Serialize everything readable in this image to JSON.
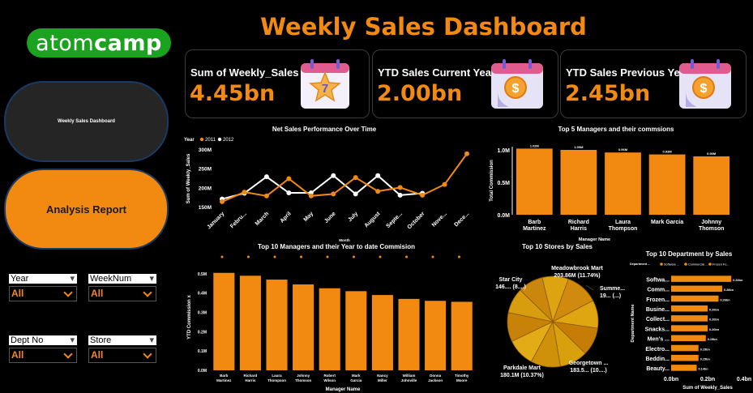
{
  "logo": {
    "light": "atom",
    "bold": "camp"
  },
  "title": "Weekly Sales Dashboard",
  "nav": {
    "dashboard_label": "Weekly Sales Dashboard",
    "report_label": "Analysis Report"
  },
  "kpis": [
    {
      "label": "Sum of Weekly_Sales",
      "value": "4.45bn",
      "icon": "star-calendar-icon"
    },
    {
      "label": "YTD Sales Current Year",
      "value": "2.00bn",
      "icon": "dollar-calendar-icon"
    },
    {
      "label": "YTD Sales Previous Year",
      "value": "2.45bn",
      "icon": "dollar-calendar-icon"
    }
  ],
  "calendar_badge": "7",
  "slicers": [
    {
      "label": "Year",
      "value": "All"
    },
    {
      "label": "WeekNum",
      "value": "All"
    },
    {
      "label": "Dept No",
      "value": "All"
    },
    {
      "label": "Store",
      "value": "All"
    }
  ],
  "colors": {
    "accent": "#f28a12",
    "white": "#ffffff",
    "background": "#000000"
  },
  "chart_data": [
    {
      "type": "line",
      "title": "Net Sales Performance Over Time",
      "xlabel": "Month",
      "ylabel": "Sum of Weekly_Sales",
      "legend_title": "Year",
      "categories": [
        "January",
        "Febru...",
        "March",
        "April",
        "May",
        "June",
        "July",
        "August",
        "Septe...",
        "October",
        "Nove...",
        "Dece..."
      ],
      "y_ticks": [
        "150M",
        "200M",
        "250M",
        "300M"
      ],
      "ylim": [
        150,
        300
      ],
      "series": [
        {
          "name": "2011",
          "color": "#f28a12",
          "values": [
            165,
            190,
            180,
            225,
            180,
            185,
            228,
            192,
            202,
            182,
            210,
            290
          ]
        },
        {
          "name": "2012",
          "color": "#ffffff",
          "values": [
            172,
            187,
            230,
            188,
            188,
            233,
            185,
            233,
            182,
            187,
            null,
            null
          ]
        }
      ]
    },
    {
      "type": "bar",
      "title": "Top 5 Managers and their commsions",
      "xlabel": "Manager Name",
      "ylabel": "Total Commission",
      "categories": [
        "Barb Martinez",
        "Richard Harris",
        "Laura Thompson",
        "Mark Garcia",
        "Johnny Thomson"
      ],
      "values": [
        1.02,
        1.0,
        0.96,
        0.93,
        0.9
      ],
      "data_labels": [
        "1.02M",
        "1.00M",
        "0.96M",
        "0.93M",
        "0.90M"
      ],
      "y_ticks": [
        "0.0M",
        "0.5M",
        "1.0M"
      ],
      "ylim": [
        0,
        1.05
      ]
    },
    {
      "type": "bar",
      "title": "Top 10 Managers and their Year to date Commision",
      "xlabel": "Manager Name",
      "ylabel": "YTD Commission x",
      "categories": [
        "Barb Martinez",
        "Richard Harris",
        "Laura Thompson",
        "Johnny Thomson",
        "Robert Wilson",
        "Mark Garcia",
        "Nancy Miller",
        "William Johnville",
        "Donna Jackson",
        "Timothy Moore"
      ],
      "values": [
        0.505,
        0.49,
        0.47,
        0.445,
        0.425,
        0.41,
        0.39,
        0.37,
        0.36,
        0.355
      ],
      "y_ticks": [
        "0.0M",
        "0.1M",
        "0.2M",
        "0.3M",
        "0.4M",
        "0.5M"
      ],
      "ylim": [
        0,
        0.55
      ]
    },
    {
      "type": "pie",
      "title": "Top 10 Stores by Sales",
      "slices": [
        11.74,
        10,
        10,
        10,
        10.56,
        10,
        10.37,
        9,
        9,
        9.33
      ],
      "labels": [
        {
          "name": "Meadowbrook Mart",
          "value": "203.86M (11.74%)"
        },
        {
          "name": "Summe...",
          "value": "19... (...)"
        },
        {
          "name": "Georgetown ...",
          "value": "183.5... (10....)"
        },
        {
          "name": "Parkdale Mart",
          "value": "180.1M (10.37%)"
        },
        {
          "name": "Star City",
          "value": "146.... (8....)"
        }
      ]
    },
    {
      "type": "bar",
      "orientation": "horizontal",
      "title": "Top 10 Department by Sales",
      "xlabel": "Sum of Weekly_Sales",
      "ylabel": "Department Name",
      "legend_title": "Department ...",
      "legend": [
        "Software ...",
        "Commercial ...",
        "Frozen Fo..."
      ],
      "categories": [
        "Softwa...",
        "Comm...",
        "Frozen...",
        "Busine...",
        "Collect...",
        "Snacks...",
        "Men's ...",
        "Electro...",
        "Beddin...",
        "Beauty..."
      ],
      "values": [
        0.33,
        0.28,
        0.26,
        0.2,
        0.2,
        0.2,
        0.19,
        0.15,
        0.15,
        0.14
      ],
      "data_labels": [
        "0.33bn",
        "0.28bn",
        "0.26bn",
        "0.20bn",
        "0.20bn",
        "0.20bn",
        "0.19bn",
        "0.15bn",
        "0.15bn",
        "0.14bn"
      ],
      "x_ticks": [
        "0.0bn",
        "0.2bn",
        "0.4bn"
      ],
      "xlim": [
        0,
        0.4
      ]
    }
  ]
}
